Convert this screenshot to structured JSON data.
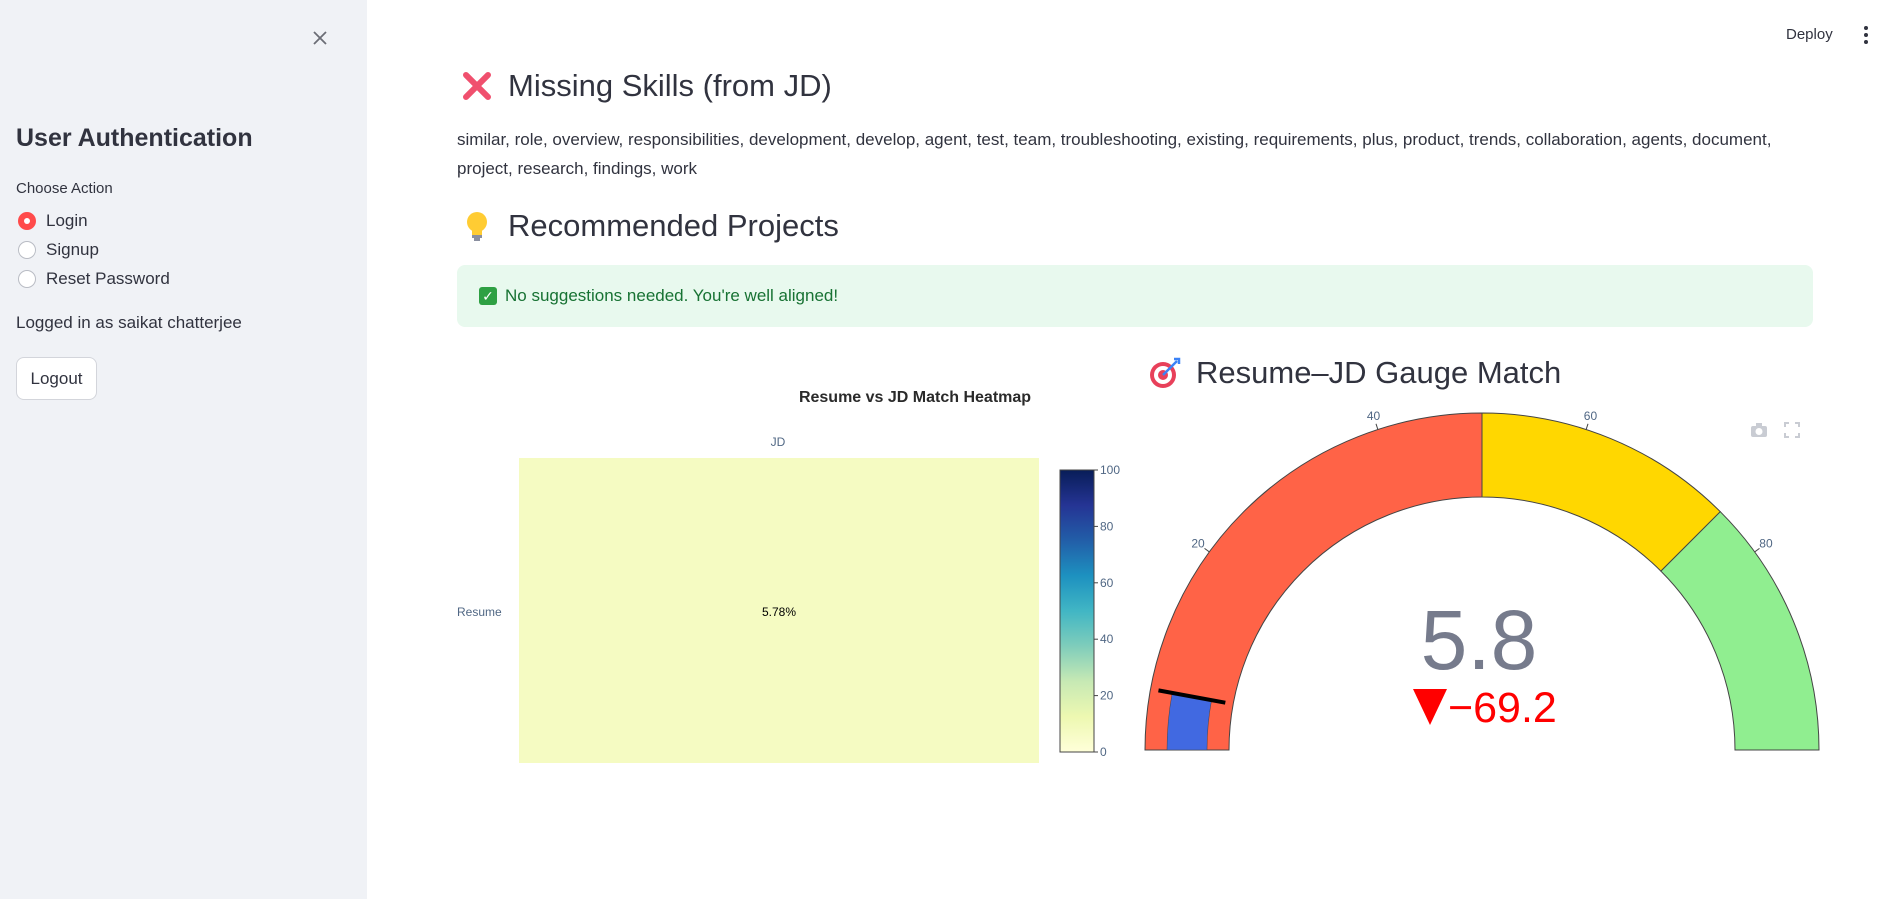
{
  "sidebar": {
    "title": "User Authentication",
    "choose_label": "Choose Action",
    "options": [
      {
        "label": "Login",
        "selected": true
      },
      {
        "label": "Signup",
        "selected": false
      },
      {
        "label": "Reset Password",
        "selected": false
      }
    ],
    "logged_in_text": "Logged in as saikat chatterjee",
    "logout_label": "Logout",
    "close_icon": "close-icon"
  },
  "topbar": {
    "deploy_label": "Deploy",
    "menu_icon": "kebab-menu-icon"
  },
  "missing": {
    "icon": "cross-mark-icon",
    "heading": "Missing Skills (from JD)",
    "text": "similar, role, overview, responsibilities, development, develop, agent, test, team, troubleshooting, existing, requirements, plus, product, trends, collaboration, agents, document, project, research, findings, work"
  },
  "projects": {
    "icon": "light-bulb-icon",
    "heading": "Recommended Projects",
    "alert_icon": "check-mark-icon",
    "alert_text": "No suggestions needed. You're well aligned!"
  },
  "gauge_section": {
    "icon": "target-icon",
    "heading": "Resume–JD Gauge Match"
  },
  "colors": {
    "accent": "#ff4b4b",
    "gauge_red": "#ff6347",
    "gauge_yellow": "#ffd700",
    "gauge_green": "#90ee90",
    "gauge_bar": "#4169e1",
    "delta_red": "#ff0000",
    "heatmap_cell": "#f5fbc2"
  },
  "chart_data": [
    {
      "type": "heatmap",
      "title": "Resume vs JD Match Heatmap",
      "x": [
        "JD"
      ],
      "y": [
        "Resume"
      ],
      "values": [
        [
          5.78
        ]
      ],
      "cell_labels": [
        [
          "5.78%"
        ]
      ],
      "colorscale": "YlGnBu",
      "zrange": [
        0,
        100
      ],
      "colorbar_ticks": [
        "0",
        "20",
        "40",
        "60",
        "80",
        "100"
      ]
    },
    {
      "type": "gauge",
      "value": 5.8,
      "value_label": "5.8",
      "delta": -69.2,
      "delta_label": "−69.2",
      "range": [
        0,
        100
      ],
      "ticks": [
        "20",
        "40",
        "60",
        "80"
      ],
      "tick_values": [
        20,
        40,
        60,
        80
      ],
      "steps": [
        {
          "from": 0,
          "to": 50,
          "color": "#ff6347"
        },
        {
          "from": 50,
          "to": 75,
          "color": "#ffd700"
        },
        {
          "from": 75,
          "to": 100,
          "color": "#90ee90"
        }
      ],
      "threshold": 5.8,
      "bar_color": "#4169e1"
    }
  ],
  "modebar": {
    "camera_icon": "camera-icon",
    "fullscreen_icon": "fullscreen-icon"
  }
}
